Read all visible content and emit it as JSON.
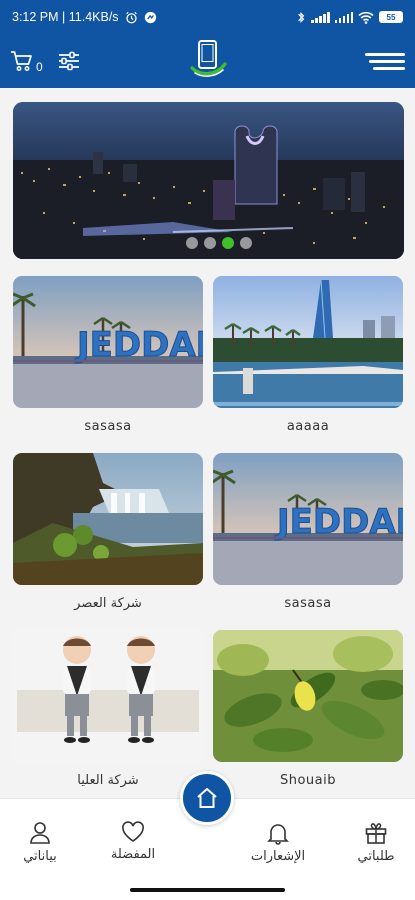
{
  "status_bar": {
    "time_info": "3:12 PM | 11.4KB/s",
    "battery": "55"
  },
  "app_bar": {
    "cart_count": "0",
    "icons": [
      "cart-icon",
      "filter-sliders-icon",
      "app-logo",
      "menu-icon"
    ]
  },
  "banner": {
    "dots": 4,
    "active_dot": 2
  },
  "grid": {
    "items": [
      {
        "label": "sasasa",
        "image": "jeddah-sign"
      },
      {
        "label": "aaaaa",
        "image": "jeddah-waterfront"
      },
      {
        "label": "شركة العصر",
        "image": "waterfall"
      },
      {
        "label": "sasasa",
        "image": "jeddah-sign"
      },
      {
        "label": "شركة العليا",
        "image": "toddlers"
      },
      {
        "label": "Shouaib",
        "image": "lemon-tree"
      }
    ]
  },
  "bottom_nav": {
    "profile": "بياناتي",
    "favorites": "المفضلة",
    "notifications": "الإشعارات",
    "orders": "طلباتي"
  },
  "colors": {
    "primary": "#0f55a3",
    "active_dot": "#3fbf2a"
  }
}
